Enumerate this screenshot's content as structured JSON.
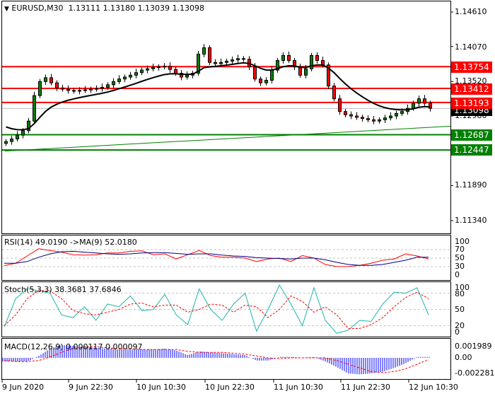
{
  "header": {
    "symbol": "EURUSD,M30",
    "open": "1.13111",
    "high": "1.13180",
    "low": "1.13039",
    "close": "1.13098"
  },
  "price_axis": [
    "1.14610",
    "1.14070",
    "1.13520",
    "1.12980",
    "1.11890",
    "1.11340"
  ],
  "levels": [
    {
      "value": "1.13754",
      "color": "#ff0000"
    },
    {
      "value": "1.13412",
      "color": "#ff0000"
    },
    {
      "value": "1.13193",
      "color": "#ff0000"
    },
    {
      "value": "1.12687",
      "color": "#008000"
    },
    {
      "value": "1.12447",
      "color": "#008000"
    }
  ],
  "current_price": "1.13098",
  "rsi": {
    "label": "RSI(14) 49.0190  ->MA(9) 52.0180",
    "axis": [
      "100",
      "70",
      "50",
      "30",
      "0"
    ]
  },
  "stoch": {
    "label": "Stoch(5,3,3) 38.3681 37.6846",
    "axis": [
      "100",
      "80",
      "50",
      "20",
      "0"
    ]
  },
  "macd": {
    "label": "MACD(12,26,9) 0.000117 0.000097",
    "axis": [
      "0.001989",
      "0.00",
      "-0.002281"
    ]
  },
  "time_axis": [
    "9 Jun 2020",
    "9 Jun 22:30",
    "10 Jun 10:30",
    "10 Jun 22:30",
    "11 Jun 10:30",
    "11 Jun 22:30",
    "12 Jun 10:30"
  ],
  "colors": {
    "bull": "#008000",
    "bear": "#ff0000",
    "resistance": "#ff0000",
    "support": "#008000",
    "rsi": "#ff0000",
    "rsi_ma": "#000080",
    "stoch_k": "#20b2aa",
    "stoch_d": "#ff0000",
    "macd_hist": "#0000ff",
    "macd_signal": "#ff0000"
  },
  "chart_data": [
    {
      "type": "candlestick",
      "title": "EURUSD,M30",
      "ylim": [
        1.1134,
        1.1461
      ],
      "closes": [
        1.1258,
        1.1262,
        1.1268,
        1.1275,
        1.129,
        1.133,
        1.1352,
        1.1358,
        1.135,
        1.1342,
        1.134,
        1.1338,
        1.1337,
        1.1338,
        1.1339,
        1.134,
        1.1341,
        1.1343,
        1.1347,
        1.1352,
        1.1356,
        1.1359,
        1.1362,
        1.1366,
        1.137,
        1.1372,
        1.1374,
        1.1375,
        1.1376,
        1.1371,
        1.1365,
        1.1359,
        1.1362,
        1.1365,
        1.1395,
        1.1405,
        1.1382,
        1.138,
        1.1382,
        1.1384,
        1.1386,
        1.1388,
        1.1387,
        1.1375,
        1.1356,
        1.135,
        1.1354,
        1.137,
        1.1385,
        1.1393,
        1.1385,
        1.1375,
        1.1362,
        1.1372,
        1.1393,
        1.1385,
        1.1378,
        1.1345,
        1.1325,
        1.1305,
        1.13,
        1.1298,
        1.1296,
        1.1294,
        1.1292,
        1.129,
        1.1292,
        1.1295,
        1.1298,
        1.1302,
        1.1305,
        1.131,
        1.1318,
        1.1325,
        1.1318,
        1.131
      ],
      "horizontal_levels": [
        1.13754,
        1.13412,
        1.13193,
        1.12687,
        1.12447
      ],
      "trendline": [
        1.1243,
        1.1282
      ]
    },
    {
      "type": "line",
      "title": "RSI(14)",
      "ylim": [
        0,
        100
      ],
      "series": [
        {
          "name": "RSI",
          "values": [
            32,
            38,
            55,
            72,
            68,
            64,
            58,
            57,
            58,
            62,
            62,
            66,
            67,
            58,
            60,
            48,
            58,
            68,
            56,
            52,
            52,
            50,
            42,
            48,
            50,
            42,
            56,
            50,
            35,
            30,
            30,
            33,
            38,
            45,
            48,
            60,
            55,
            48
          ]
        },
        {
          "name": "MA(9)",
          "values": [
            38,
            38,
            42,
            52,
            60,
            65,
            66,
            64,
            62,
            60,
            59,
            60,
            62,
            63,
            63,
            61,
            59,
            60,
            60,
            57,
            55,
            54,
            51,
            50,
            49,
            48,
            50,
            50,
            46,
            40,
            35,
            33,
            33,
            35,
            40,
            45,
            52,
            52
          ]
        }
      ],
      "levels": [
        70,
        50,
        30
      ]
    },
    {
      "type": "line",
      "title": "Stoch(5,3,3)",
      "ylim": [
        0,
        100
      ],
      "series": [
        {
          "name": "%K",
          "values": [
            18,
            70,
            88,
            85,
            80,
            40,
            35,
            55,
            30,
            60,
            55,
            75,
            48,
            50,
            78,
            40,
            22,
            88,
            50,
            30,
            60,
            80,
            10,
            50,
            95,
            60,
            20,
            90,
            30,
            6,
            12,
            30,
            28,
            60,
            82,
            80,
            90,
            40
          ]
        },
        {
          "name": "%D",
          "values": [
            20,
            40,
            70,
            85,
            84,
            70,
            48,
            42,
            40,
            45,
            50,
            60,
            62,
            55,
            58,
            58,
            45,
            50,
            60,
            58,
            45,
            58,
            55,
            35,
            50,
            75,
            65,
            45,
            55,
            40,
            15,
            15,
            22,
            35,
            55,
            72,
            82,
            70
          ]
        }
      ],
      "levels": [
        80,
        50,
        20
      ]
    },
    {
      "type": "bar",
      "title": "MACD(12,26,9)",
      "ylim": [
        -0.002281,
        0.001989
      ],
      "series": [
        {
          "name": "MACD",
          "values": [
            -0.0004,
            -0.0004,
            -0.0004,
            0.0002,
            0.001,
            0.0014,
            0.0013,
            0.0012,
            0.0011,
            0.001,
            0.0009,
            0.0009,
            0.0009,
            0.0009,
            0.001,
            0.0008,
            0.0003,
            0.0007,
            0.0006,
            0.0005,
            0.0004,
            0.0003,
            -0.0003,
            -0.0003,
            0.0001,
            0.0001,
            0.0,
            0.0001,
            -0.0004,
            -0.001,
            -0.0017,
            -0.0018,
            -0.0017,
            -0.0015,
            -0.0011,
            -0.0006,
            0.0001,
            0.0001
          ]
        },
        {
          "name": "Signal",
          "values": [
            -0.0003,
            -0.0004,
            -0.0004,
            -0.0003,
            0.0001,
            0.0006,
            0.001,
            0.0012,
            0.0012,
            0.0011,
            0.001,
            0.001,
            0.0009,
            0.0009,
            0.0009,
            0.0009,
            0.0007,
            0.0006,
            0.0006,
            0.0006,
            0.0005,
            0.0004,
            0.0002,
            0.0,
            -0.0001,
            0.0,
            0.0,
            0.0,
            0.0,
            -0.0003,
            -0.0007,
            -0.0011,
            -0.0015,
            -0.0016,
            -0.0015,
            -0.0012,
            -0.0007,
            -0.0002
          ]
        }
      ]
    }
  ]
}
